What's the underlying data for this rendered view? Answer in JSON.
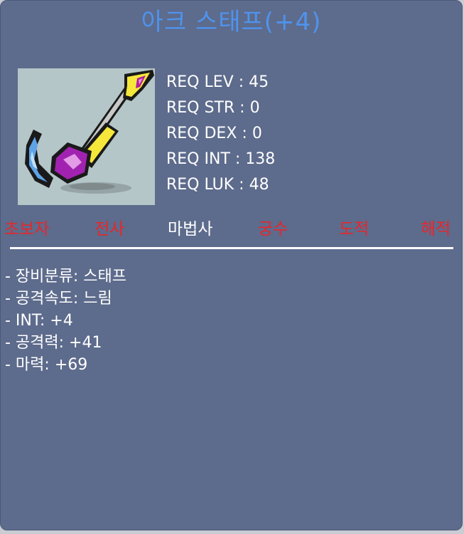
{
  "item": {
    "name": "아크 스태프(+4)"
  },
  "requirements": [
    {
      "label": "REQ LEV",
      "value": "45"
    },
    {
      "label": "REQ STR",
      "value": "0"
    },
    {
      "label": "REQ DEX",
      "value": "0"
    },
    {
      "label": "REQ INT",
      "value": "138"
    },
    {
      "label": "REQ LUK",
      "value": "48"
    }
  ],
  "jobs": [
    {
      "label": "초보자",
      "available": false
    },
    {
      "label": "전사",
      "available": false
    },
    {
      "label": "마법사",
      "available": true
    },
    {
      "label": "궁수",
      "available": false
    },
    {
      "label": "도적",
      "available": false
    },
    {
      "label": "해적",
      "available": false
    }
  ],
  "stats": [
    "- 장비분류: 스태프",
    "- 공격속도: 느림",
    "- INT: +4",
    "- 공격력: +41",
    "- 마력: +69"
  ],
  "colors": {
    "background": "#5d6b8c",
    "title": "#4f93ee",
    "unavailable_job": "#e8262a",
    "available_job": "#ffffff",
    "image_background": "#b4c6c8"
  },
  "icon": "staff-item-icon"
}
